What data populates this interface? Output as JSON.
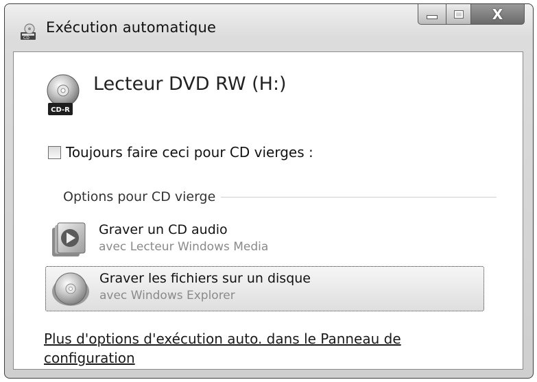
{
  "window": {
    "title": "Exécution automatique",
    "title_icon": "autoplay-icon",
    "close_glyph": "X"
  },
  "device": {
    "title": "Lecteur DVD RW (H:)",
    "icon": "cd-r-disc-icon",
    "badge": "CD-R"
  },
  "always": {
    "label": "Toujours faire ceci pour CD vierges :",
    "checked": false
  },
  "group": {
    "label": "Options pour CD vierge"
  },
  "options": [
    {
      "main": "Graver un CD audio",
      "sub": "avec Lecteur Windows Media",
      "icon": "media-player-icon"
    },
    {
      "main": "Graver les fichiers sur un disque",
      "sub": "avec Windows Explorer",
      "icon": "disc-burn-icon"
    }
  ],
  "more_link": "Plus d'options d'exécution auto. dans le Panneau de configuration"
}
